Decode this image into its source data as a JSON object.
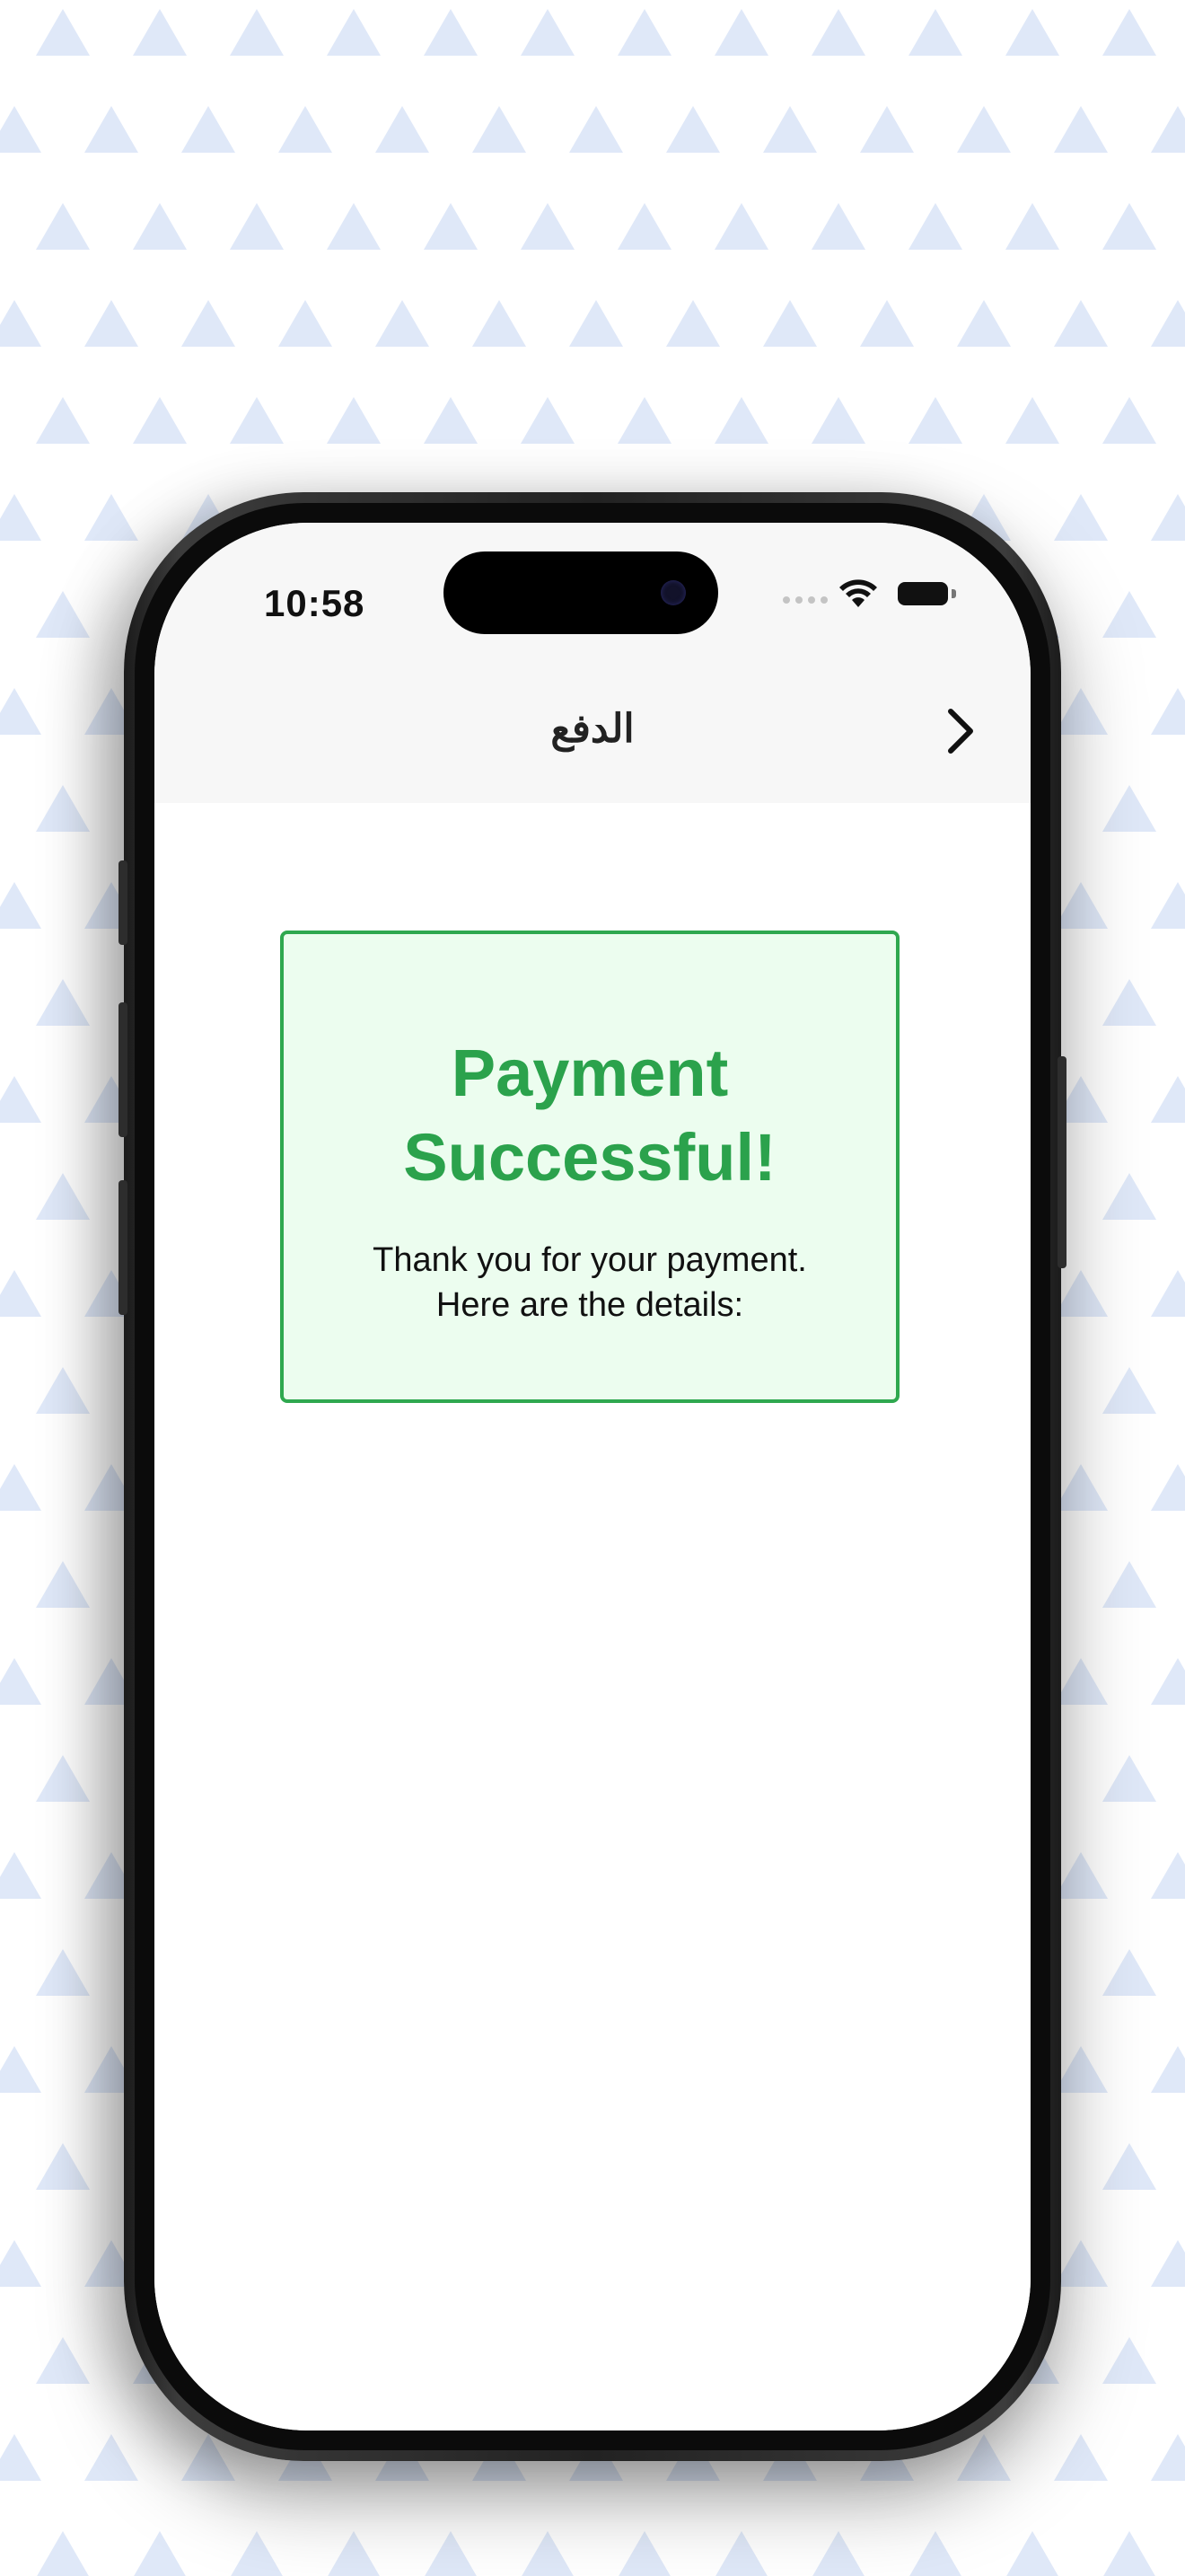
{
  "status_bar": {
    "time": "10:58"
  },
  "nav": {
    "title": "الدفع",
    "back_icon": "chevron-right-icon"
  },
  "success_card": {
    "title_line1": "Payment",
    "title_line2": "Successful!",
    "text_line1": "Thank you for your payment.",
    "text_line2": "Here are the details:"
  },
  "colors": {
    "success_green": "#2ba24c",
    "success_border": "#2fa84f",
    "success_bg": "#ecfdef",
    "pattern_triangle": "#dfe8f8",
    "nav_bg": "#f7f7f7"
  }
}
